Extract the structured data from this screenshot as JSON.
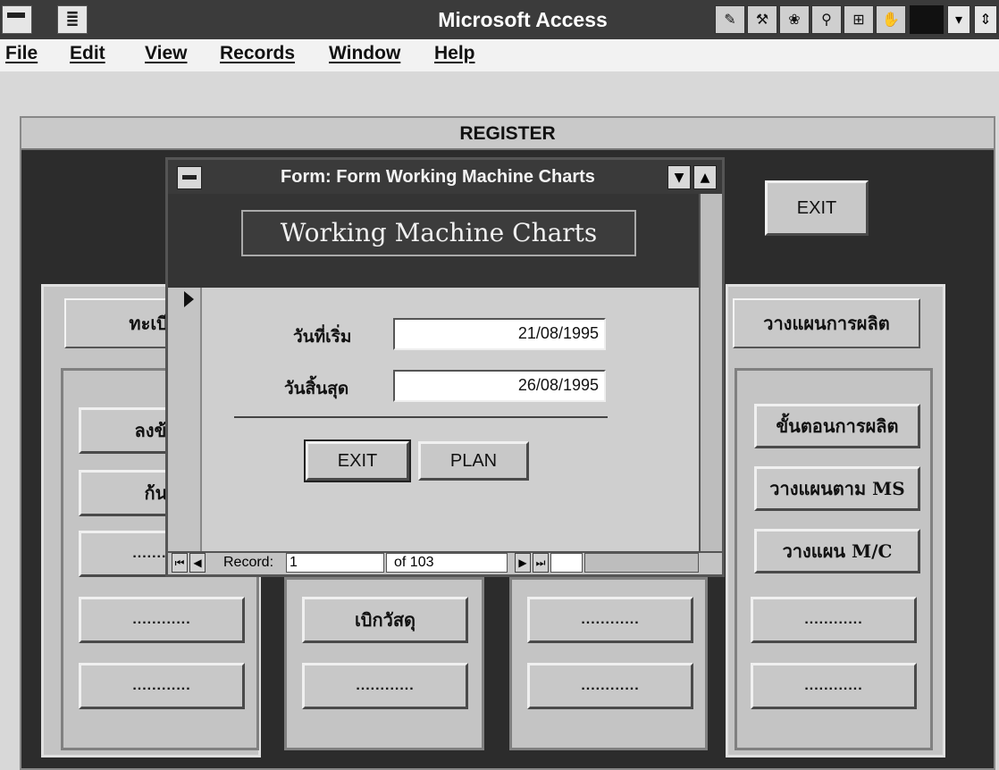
{
  "app": {
    "title": "Microsoft Access"
  },
  "menu": {
    "items": [
      "File",
      "Edit",
      "View",
      "Records",
      "Window",
      "Help"
    ]
  },
  "toolbar_icons": [
    "tool-icon-1",
    "tool-icon-2",
    "tool-icon-3",
    "tool-icon-4",
    "tool-icon-5",
    "tool-icon-6"
  ],
  "register": {
    "title": "REGISTER",
    "exit_label": "EXIT",
    "left_panel": {
      "header": "ทะเบีย",
      "buttons": [
        "ลงข้อมู",
        "ก้นห",
        "............",
        "............",
        "............"
      ]
    },
    "middle_panel": {
      "buttons": [
        "เบิกวัสดุ",
        "............"
      ]
    },
    "third_panel": {
      "buttons": [
        "............",
        "............"
      ]
    },
    "right_panel": {
      "header": "วางแผนการผลิต",
      "buttons": [
        "ขั้นตอนการผลิต",
        "วางแผนตาม MS",
        "วางแผน M/C",
        "............",
        "............"
      ]
    }
  },
  "form": {
    "window_title": "Form: Form Working Machine Charts",
    "heading": "Working Machine Charts",
    "start_label": "วันที่เริ่ม",
    "start_value": "21/08/1995",
    "end_label": "วันสิ้นสุด",
    "end_value": "26/08/1995",
    "exit_label": "EXIT",
    "plan_label": "PLAN",
    "nav": {
      "record_label": "Record:",
      "record_value": "1",
      "of_text": "of  103"
    }
  }
}
